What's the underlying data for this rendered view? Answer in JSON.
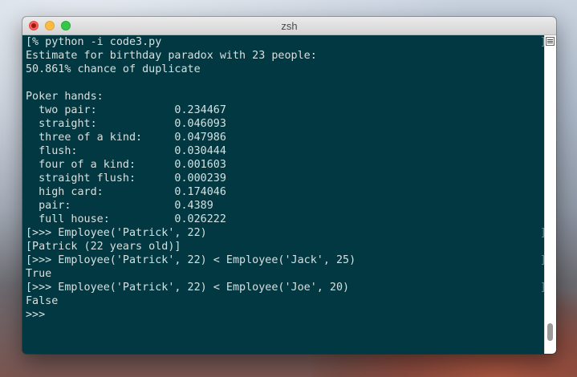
{
  "window": {
    "title": "zsh"
  },
  "terminal": {
    "lines": [
      "[% python -i code3.py",
      "Estimate for birthday paradox with 23 people:",
      "50.861% chance of duplicate",
      "",
      "Poker hands:",
      "  two pair:            0.234467",
      "  straight:            0.046093",
      "  three of a kind:     0.047986",
      "  flush:               0.030444",
      "  four of a kind:      0.001603",
      "  straight flush:      0.000239",
      "  high card:           0.174046",
      "  pair:                0.4389",
      "  full house:          0.026222",
      "[>>> Employee('Patrick', 22)",
      "[Patrick (22 years old)]",
      "[>>> Employee('Patrick', 22) < Employee('Jack', 25)",
      "True",
      "[>>> Employee('Patrick', 22) < Employee('Joe', 20)",
      "False",
      ">>>"
    ],
    "right_bracket": "]"
  },
  "colors": {
    "terminal_bg": "#013841",
    "terminal_text": "#d7e0e0",
    "titlebar": "#e0e0e0",
    "close": "#fc605c",
    "minimize": "#fdbc40",
    "maximize": "#34c84a"
  }
}
